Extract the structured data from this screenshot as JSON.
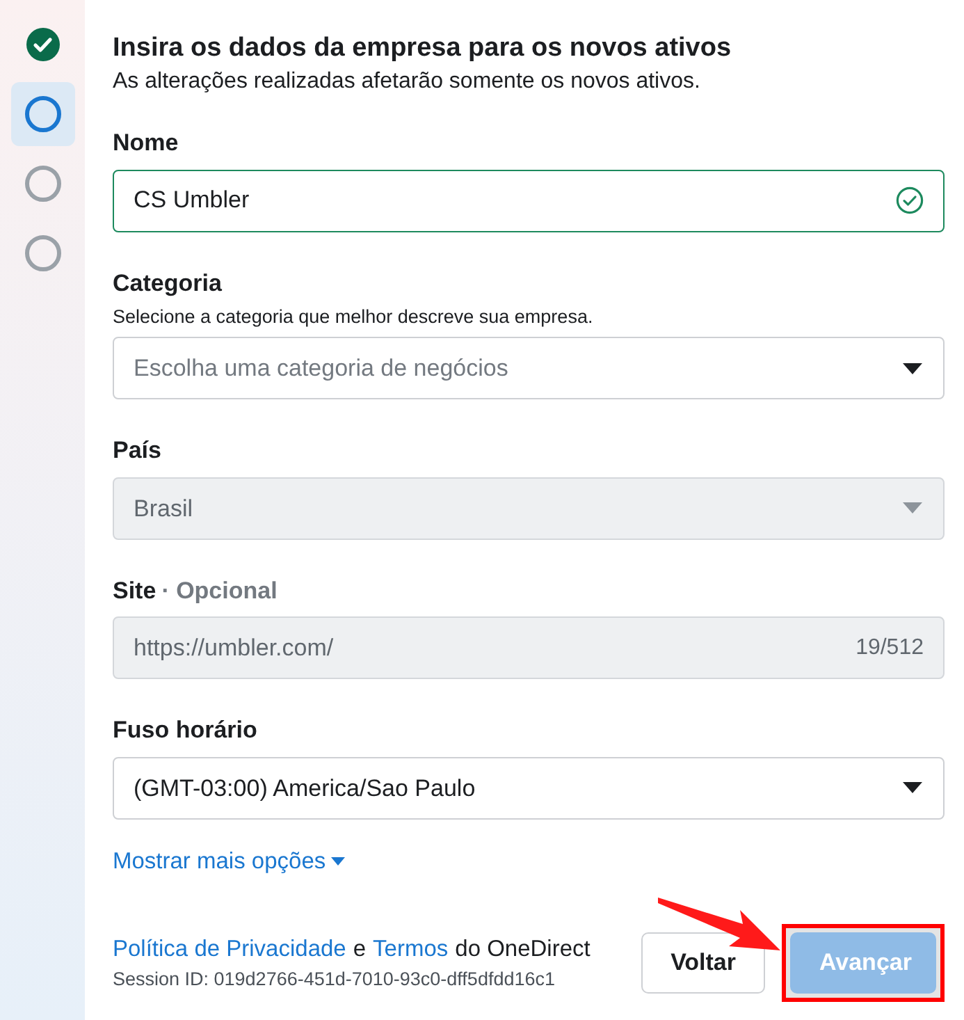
{
  "steps": [
    {
      "kind": "done"
    },
    {
      "kind": "current"
    },
    {
      "kind": "pending"
    },
    {
      "kind": "pending"
    }
  ],
  "header": {
    "title": "Insira os dados da empresa para os novos ativos",
    "subtitle": "As alterações realizadas afetarão somente os novos ativos."
  },
  "fields": [
    {
      "kind": "text",
      "label": "Nome",
      "value": "CS Umbler",
      "valid": true,
      "disabled": false
    },
    {
      "kind": "select",
      "label": "Categoria",
      "help": "Selecione a categoria que melhor descreve sua empresa.",
      "placeholder": "Escolha uma categoria de negócios",
      "disabled": false
    },
    {
      "kind": "select",
      "label": "País",
      "value": "Brasil",
      "disabled": true
    },
    {
      "kind": "text",
      "label": "Site",
      "optional": "· Opcional",
      "value": "https://umbler.com/",
      "counter": "19/512",
      "disabled": true
    },
    {
      "kind": "select",
      "label": "Fuso horário",
      "value": "(GMT-03:00) America/Sao Paulo",
      "disabled": false
    }
  ],
  "more_options": "Mostrar mais opções",
  "footer": {
    "privacy_link": "Política de Privacidade",
    "conjunction": "e",
    "terms_link": "Termos",
    "suffix": "do OneDirect",
    "session": "Session ID: 019d2766-451d-7010-93c0-dff5dfdd16c1"
  },
  "buttons": [
    {
      "label": "Voltar",
      "kind": "secondary",
      "disabled": false
    },
    {
      "label": "Avançar",
      "kind": "primary",
      "disabled": true
    }
  ]
}
